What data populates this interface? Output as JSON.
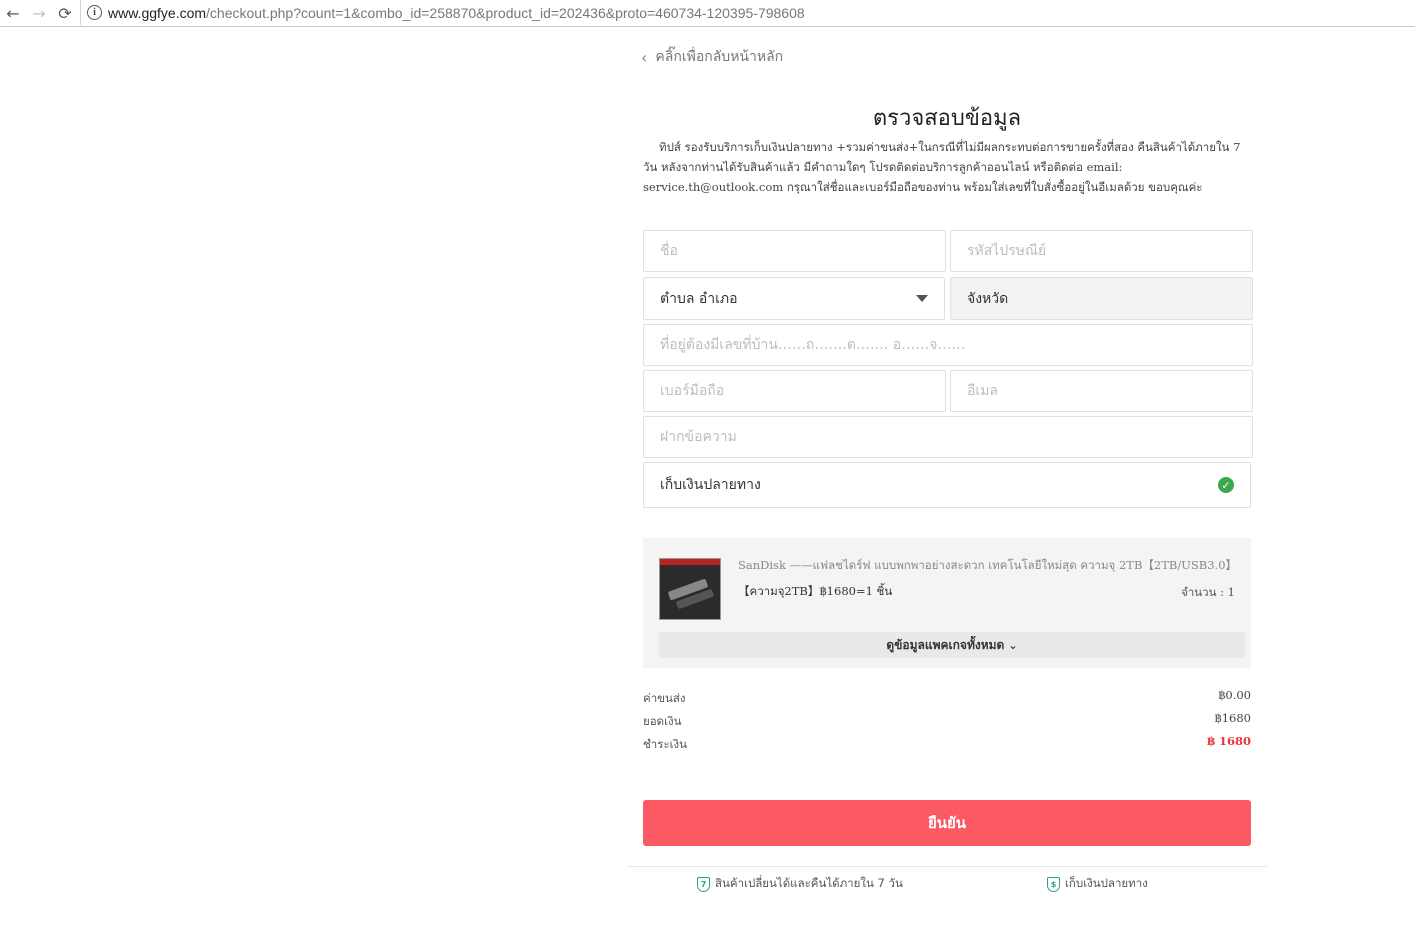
{
  "browser": {
    "back": "←",
    "forward": "→",
    "reload": "⟳",
    "info": "i",
    "url_host": "www.ggfye.com",
    "url_path": "/checkout.php?count=1&combo_id=258870&product_id=202436&proto=460734-120395-798608"
  },
  "header": {
    "back_label": "คลิ๊กเพื่อกลับหน้าหลัก",
    "title": "ตรวจสอบข้อมูล",
    "tips": "ทิปส์ รองรับบริการเก็บเงินปลายทาง +รวมค่าขนส่ง+ในกรณีที่ไม่มีผลกระทบต่อการขายครั้งที่สอง คืนสินค้าได้ภายใน 7 วัน หลังจากท่านได้รับสินค้าแล้ว มีคำถามใดๆ โปรดติดต่อบริการลูกค้าออนไลน์ หรือติดต่อ email: service.th@outlook.com กรุณาใส่ชื่อและเบอร์มือถือของท่าน พร้อมใส่เลขที่ใบสั่งซื้ออยู่ในอีเมลด้วย ขอบคุณค่ะ"
  },
  "form": {
    "name_placeholder": "ชื่อ",
    "postcode_placeholder": "รหัสไปรษณีย์",
    "district_value": "ตำบล อำเภอ",
    "province_value": "จังหวัด",
    "address_placeholder": "ที่อยู่ต้องมีเลขที่บ้าน……ถ…….ต……. อ……จ……",
    "phone_placeholder": "เบอร์มือถือ",
    "email_placeholder": "อีเมล",
    "message_placeholder": "ฝากข้อความ",
    "payment_label": "เก็บเงินปลายทาง",
    "payment_check": "✓"
  },
  "product": {
    "name": "SanDisk ——แฟลชไดร์ฟ แบบพกพาอย่างสะดวก เทคโนโลยีใหม่สุด ความจุ 2TB【2TB/USB3.0】",
    "variant": "【ความจุ2TB】฿1680=1 ชิ้น",
    "qty": "จำนวน : 1",
    "more_label": "ดูข้อมูลแพคเกจทั้งหมด",
    "more_icon": "⌄"
  },
  "summary": {
    "shipping_label": "ค่าขนส่ง",
    "shipping_value": "฿0.00",
    "subtotal_label": "ยอดเงิน",
    "subtotal_value": "฿1680",
    "pay_label": "ชำระเงิน",
    "pay_value": "฿ 1680"
  },
  "actions": {
    "confirm_label": "ยืนยัน"
  },
  "footer": {
    "return_label": "สินค้าเปลี่ยนได้และคืนได้ภายใน 7 วัน",
    "return_icon": "7",
    "cod_label": "เก็บเงินปลายทาง",
    "cod_icon": "$"
  },
  "colors": {
    "accent": "#fb5a63",
    "price": "#e8353b",
    "check": "#3aa84b"
  }
}
